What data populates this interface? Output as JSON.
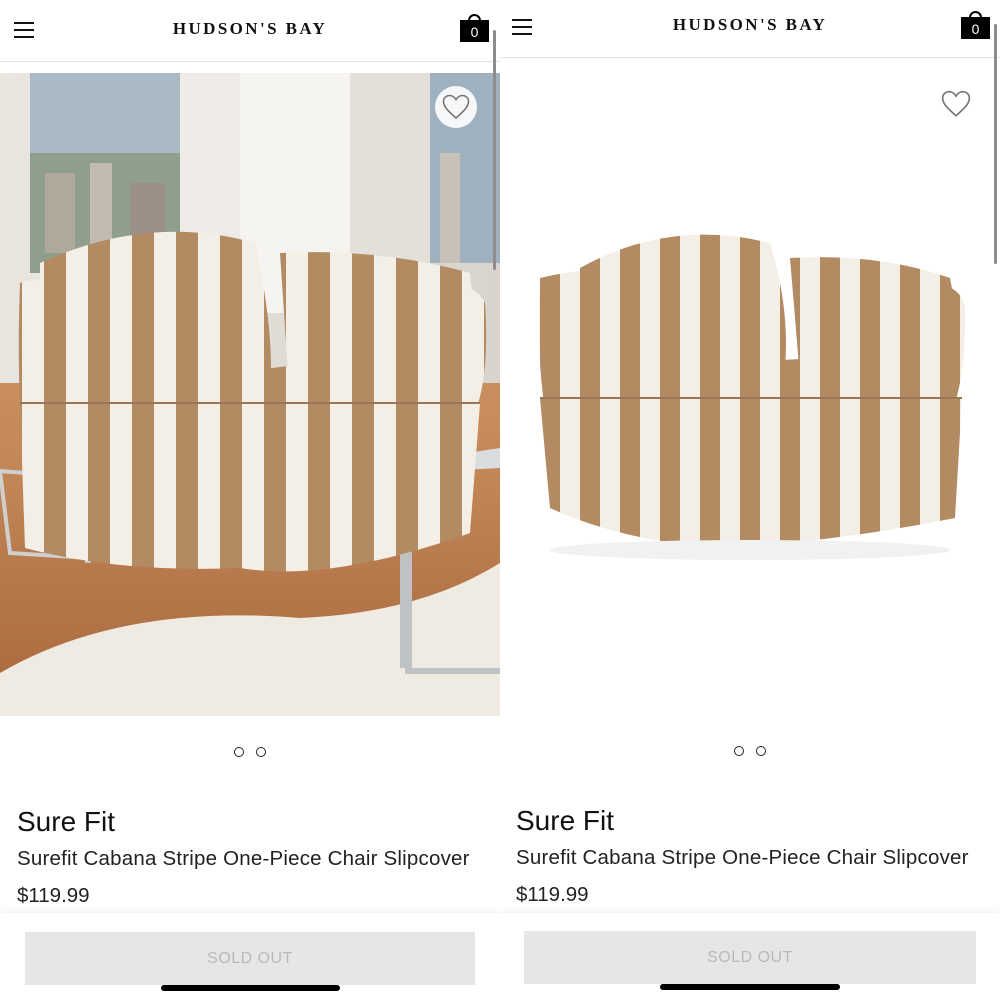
{
  "screens": [
    {
      "id": "left",
      "header": {
        "logo": "HUDSON'S BAY",
        "bag_count": "0"
      },
      "gallery": {
        "image": "striped-armchair-in-living-room-photo",
        "dots": 2
      },
      "product": {
        "brand": "Sure Fit",
        "name": "Surefit Cabana Stripe One-Piece Chair Slipcover",
        "price": "$119.99"
      },
      "cta": {
        "label": "SOLD OUT"
      }
    },
    {
      "id": "right",
      "header": {
        "logo": "HUDSON'S BAY",
        "bag_count": "0"
      },
      "gallery": {
        "image": "striped-armchair-on-white-photo",
        "dots": 2
      },
      "product": {
        "brand": "Sure Fit",
        "name": "Surefit Cabana Stripe One-Piece Chair Slipcover",
        "price": "$119.99"
      },
      "cta": {
        "label": "SOLD OUT"
      }
    }
  ],
  "icons": {
    "menu": "hamburger-icon",
    "bag": "shopping-bag-icon",
    "wishlist": "heart-outline-icon",
    "gallery_dot": "carousel-dot-icon"
  },
  "colors": {
    "stripe_tan": "#B38B62",
    "stripe_cream": "#F3EFE6",
    "button_disabled_bg": "#E6E6E6",
    "button_disabled_text": "#B9B9B9"
  }
}
